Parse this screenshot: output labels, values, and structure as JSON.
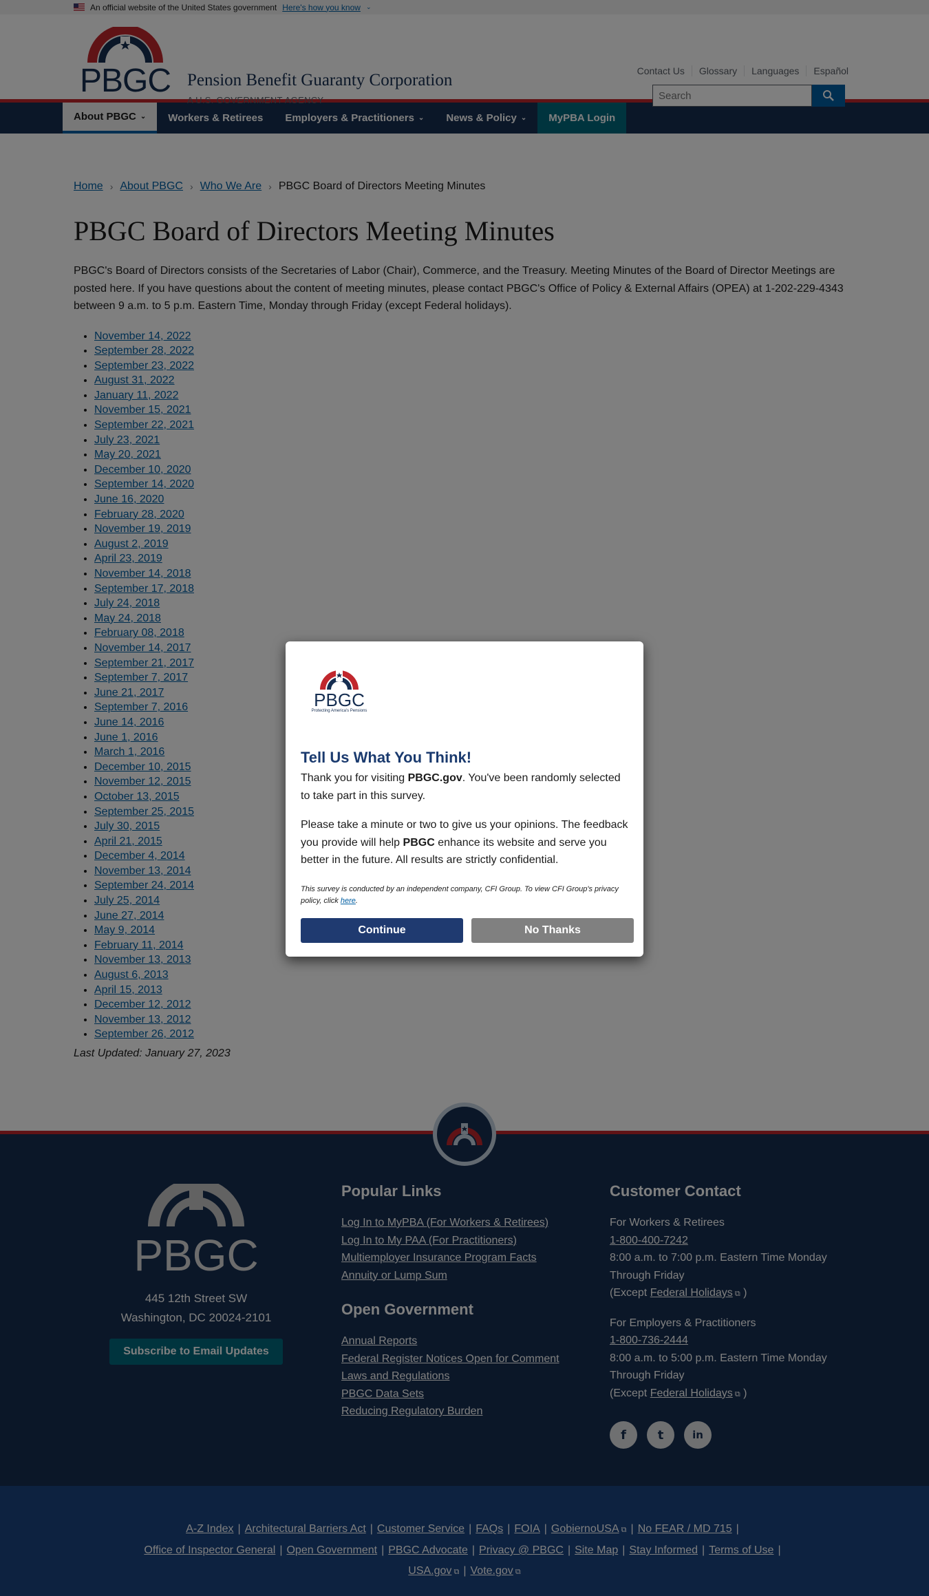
{
  "gov_banner": {
    "text": "An official website of the United States government",
    "link": "Here's how you know"
  },
  "header": {
    "logo_text": "PBGC",
    "site_name": "Pension Benefit Guaranty Corporation",
    "site_sub": "A U.S. GOVERNMENT AGENCY",
    "util_links": [
      "Contact Us",
      "Glossary",
      "Languages",
      "Español"
    ],
    "search_placeholder": "Search"
  },
  "nav": {
    "items": [
      "About PBGC",
      "Workers & Retirees",
      "Employers & Practitioners",
      "News & Policy",
      "MyPBA Login"
    ]
  },
  "breadcrumb": {
    "home": "Home",
    "about": "About PBGC",
    "who": "Who We Are",
    "current": "PBGC Board of Directors Meeting Minutes"
  },
  "main": {
    "title": "PBGC Board of Directors Meeting Minutes",
    "intro": "PBGC's Board of Directors consists of the Secretaries of Labor (Chair), Commerce, and the Treasury. Meeting Minutes of the Board of Director Meetings are posted here. If you have questions about the content of meeting minutes, please contact PBGC's Office of Policy & External Affairs (OPEA) at 1-202-229-4343 between 9 a.m. to 5 p.m. Eastern Time, Monday through Friday (except Federal holidays).",
    "minutes": [
      "November 14, 2022",
      "September 28, 2022",
      "September 23, 2022",
      "August 31, 2022",
      "January 11, 2022",
      "November 15, 2021",
      "September 22, 2021",
      "July 23, 2021",
      "May 20, 2021",
      "December 10, 2020",
      "September 14, 2020",
      "June 16, 2020",
      "February 28, 2020",
      "November 19, 2019",
      "August 2, 2019",
      "April 23, 2019",
      "November 14, 2018",
      "September 17, 2018",
      "July 24, 2018",
      "May 24, 2018",
      "February 08, 2018",
      "November 14, 2017",
      "September 21, 2017",
      "September 7, 2017",
      "June 21, 2017",
      "September 7, 2016",
      "June 14, 2016",
      "June 1, 2016",
      "March 1, 2016",
      "December 10, 2015",
      "November 12, 2015",
      "October 13, 2015",
      "September 25, 2015",
      "July 30, 2015",
      "April 21, 2015",
      "December 4, 2014",
      "November 13, 2014",
      "September 24, 2014",
      "July 25, 2014",
      "June 27, 2014",
      "May 9, 2014",
      "February 11, 2014",
      "November 13, 2013",
      "August 6, 2013",
      "April 15, 2013",
      "December 12, 2012",
      "November 13, 2012",
      "September 26, 2012"
    ],
    "updated": "Last Updated: January 27, 2023"
  },
  "footer": {
    "logo_text": "PBGC",
    "address1": "445 12th Street SW",
    "address2": "Washington, DC 20024-2101",
    "subscribe": "Subscribe to Email Updates",
    "popular_title": "Popular Links",
    "popular": [
      "Log In to MyPBA (For Workers & Retirees)",
      "Log In to My PAA (For Practitioners)",
      "Multiemployer Insurance Program Facts",
      "Annuity or Lump Sum"
    ],
    "open_gov_title": "Open Government",
    "open_gov": [
      "Annual Reports",
      "Federal Register Notices Open for Comment",
      "Laws and Regulations",
      "PBGC Data Sets",
      "Reducing Regulatory Burden"
    ],
    "contact_title": "Customer Contact",
    "workers_label": "For Workers & Retirees",
    "workers_phone": "1-800-400-7242",
    "workers_hours": "8:00 a.m. to 7:00 p.m. Eastern Time Monday Through Friday",
    "except_prefix": "(Except",
    "holidays": "Federal Holidays",
    "except_suffix": ")",
    "employers_label": "For Employers & Practitioners",
    "employers_phone": "1-800-736-2444",
    "employers_hours": "8:00 a.m. to 5:00 p.m. Eastern Time Monday Through Friday",
    "bottom_row1": [
      "A-Z Index",
      "Architectural Barriers Act",
      "Customer Service",
      "FAQs",
      "FOIA",
      "GobiernoUSA",
      "No FEAR / MD 715"
    ],
    "bottom_row2": [
      "Office of Inspector General",
      "Open Government",
      "PBGC Advocate",
      "Privacy @ PBGC",
      "Site Map",
      "Stay Informed",
      "Terms of Use"
    ],
    "bottom_row3": [
      "USA.gov",
      "Vote.gov"
    ]
  },
  "modal": {
    "logo_text": "PBGC",
    "logo_tagline": "Protecting America's Pensions",
    "title": "Tell Us What You Think!",
    "p1_a": "Thank you for visiting ",
    "p1_b": "PBGC.gov",
    "p1_c": ". You've been randomly selected to take part in this survey.",
    "p2_a": "Please take a minute or two to give us your opinions. The feedback you provide will help ",
    "p2_b": "PBGC",
    "p2_c": " enhance its website and serve you better in the future. All results are strictly confidential.",
    "p3_a": "This survey is conducted by an independent company, CFI Group. To view CFI Group's privacy policy, click ",
    "p3_link": "here",
    "p3_b": ".",
    "continue": "Continue",
    "no_thanks": "No Thanks"
  }
}
